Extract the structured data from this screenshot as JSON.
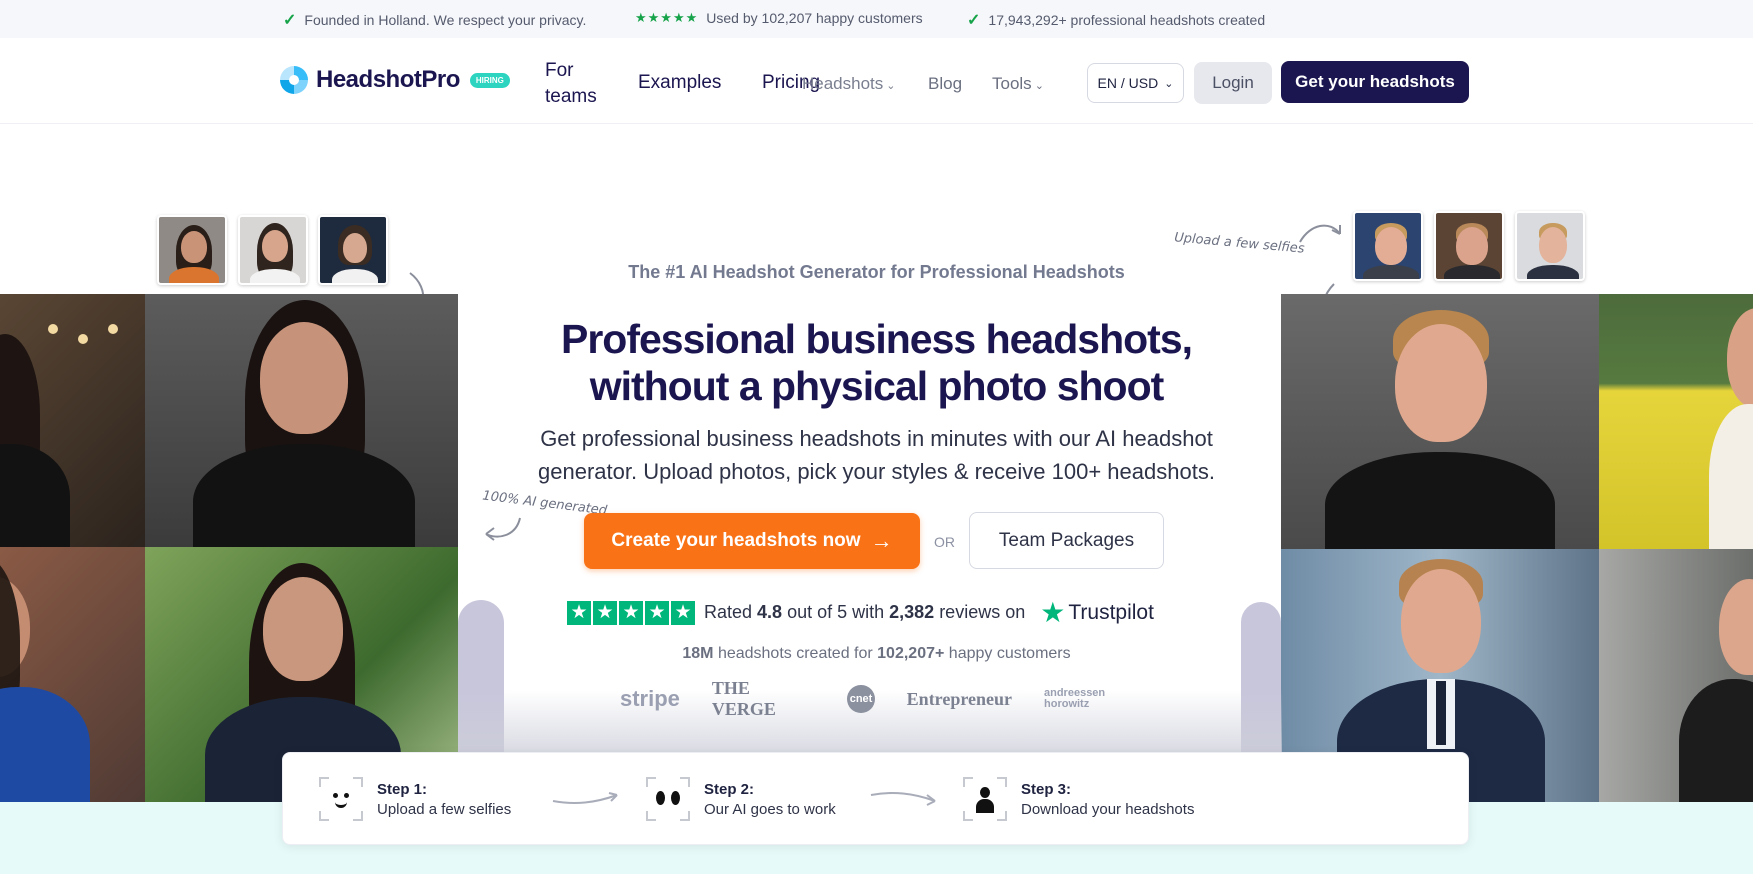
{
  "topbar": {
    "privacy": "Founded in Holland. We respect your privacy.",
    "customers": "Used by 102,207 happy customers",
    "created": "17,943,292+ professional headshots created"
  },
  "nav": {
    "logo": "HeadshotPro",
    "badge": "HIRING",
    "links": {
      "for_teams": "For teams",
      "examples": "Examples",
      "pricing": "Pricing",
      "headshots": "Headshots",
      "blog": "Blog",
      "tools": "Tools"
    },
    "lang": "EN / USD",
    "login": "Login",
    "cta": "Get your headshots"
  },
  "hero": {
    "tagline": "The #1 AI Headshot Generator for Professional Headshots",
    "title_line1": "Professional business headshots,",
    "title_line2": "without a physical photo shoot",
    "sub_line1": "Get professional business headshots in minutes with our AI headshot",
    "sub_line2": "generator. Upload photos, pick your styles & receive 100+ headshots.",
    "cta": "Create your headshots now",
    "or": "OR",
    "team": "Team Packages",
    "annot_left": "100% AI generated",
    "annot_right": "Upload a few selfies"
  },
  "rating": {
    "prefix": "Rated",
    "score": "4.8",
    "mid": "out of 5 with",
    "reviews": "2,382",
    "suffix": "reviews on",
    "platform": "Trustpilot"
  },
  "count": {
    "a": "18M",
    "b": "headshots created for",
    "c": "102,207+",
    "d": "happy customers"
  },
  "press": [
    "stripe",
    "THE VERGE",
    "cnet",
    "Entrepreneur",
    "andreessen horowitz"
  ],
  "steps": [
    {
      "label": "Step 1:",
      "desc": "Upload a few selfies"
    },
    {
      "label": "Step 2:",
      "desc": "Our AI goes to work"
    },
    {
      "label": "Step 3:",
      "desc": "Download your headshots"
    }
  ],
  "colors": {
    "brand": "#1b1650",
    "accent": "#f97316",
    "trustpilot": "#00b67a",
    "check": "#16a34a"
  }
}
